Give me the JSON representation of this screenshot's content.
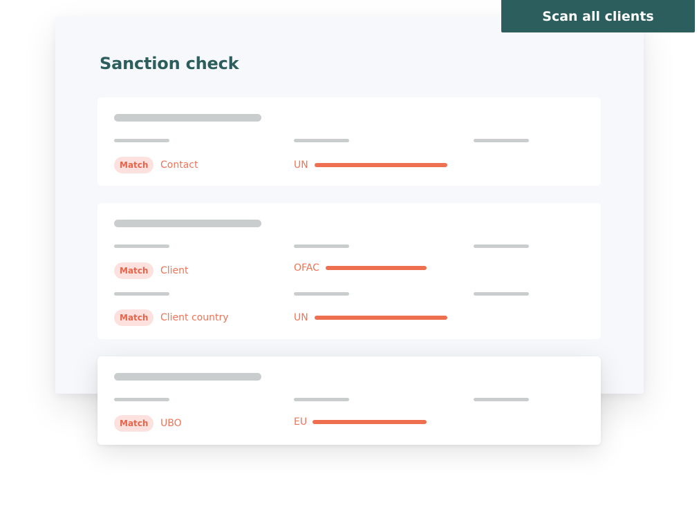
{
  "header": {
    "title": "Sanction check",
    "scan_button_label": "Scan all clients"
  },
  "colors": {
    "brand": "#2b5e5c",
    "match_text": "#e5654b",
    "match_bg": "#fde1df",
    "bar": "#ee7050",
    "skeleton": "#c9cdcd",
    "panel_bg": "#f6f8fb"
  },
  "cards": [
    {
      "matches": [
        {
          "badge": "Match",
          "field": "Contact",
          "list": "UN",
          "score": 1.0
        }
      ]
    },
    {
      "matches": [
        {
          "badge": "Match",
          "field": "Client",
          "list": "OFAC",
          "score": 0.76
        },
        {
          "badge": "Match",
          "field": "Client country",
          "list": "UN",
          "score": 1.0
        }
      ]
    },
    {
      "matches": [
        {
          "badge": "Match",
          "field": "UBO",
          "list": "EU",
          "score": 0.86
        }
      ]
    }
  ]
}
